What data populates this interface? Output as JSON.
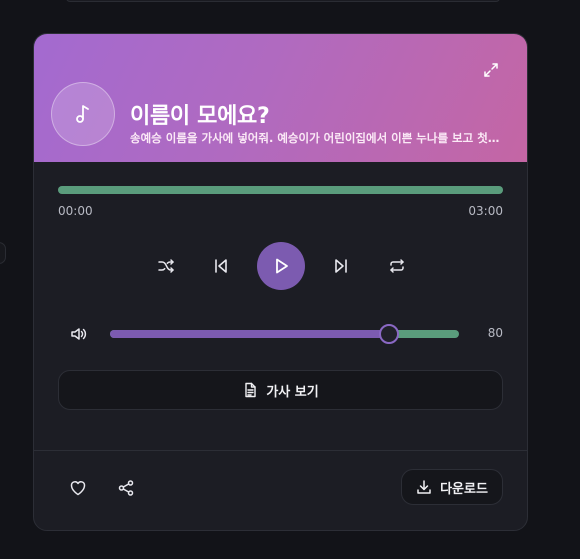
{
  "song": {
    "title": "이름이 모에요?",
    "subtitle": "송예승 이름을 가사에 넣어줘. 예승이가 어린이집에서 이쁜 누나를 보고 첫눈에 반해 이름을 물어보는 노래"
  },
  "progress": {
    "current": "00:00",
    "duration": "03:00",
    "fraction": 1.0
  },
  "volume": {
    "value": "80",
    "fraction": 0.8
  },
  "buttons": {
    "lyrics_label": "가사 보기",
    "download_label": "다운로드"
  },
  "icons": {
    "expand": "expand-icon",
    "cover": "music-note-icon",
    "shuffle": "shuffle-icon",
    "previous": "skip-back-icon",
    "play": "play-icon",
    "next": "skip-forward-icon",
    "repeat": "repeat-icon",
    "volume": "volume-icon",
    "lyrics": "document-icon",
    "like": "heart-icon",
    "share": "share-icon",
    "download": "download-icon"
  },
  "colors": {
    "header_gradient_start": "#a36ad0",
    "header_gradient_end": "#c466a4",
    "progress": "#5a9c7c",
    "accent": "#7c5bb0",
    "background": "#121318",
    "card": "#1c1d24"
  }
}
